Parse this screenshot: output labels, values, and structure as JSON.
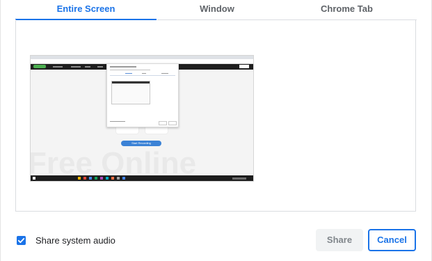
{
  "tabs": [
    {
      "label": "Entire Screen",
      "active": true
    },
    {
      "label": "Window",
      "active": false
    },
    {
      "label": "Chrome Tab",
      "active": false
    }
  ],
  "preview": {
    "watermark_text": "Free Online",
    "start_button_text": "Start Recording"
  },
  "footer": {
    "share_audio_label": "Share system audio",
    "share_audio_checked": true
  },
  "buttons": {
    "share_label": "Share",
    "cancel_label": "Cancel"
  },
  "colors": {
    "accent": "#1a73e8",
    "disabled_bg": "#f1f3f4",
    "disabled_text": "#80868b",
    "border": "#dadce0"
  }
}
